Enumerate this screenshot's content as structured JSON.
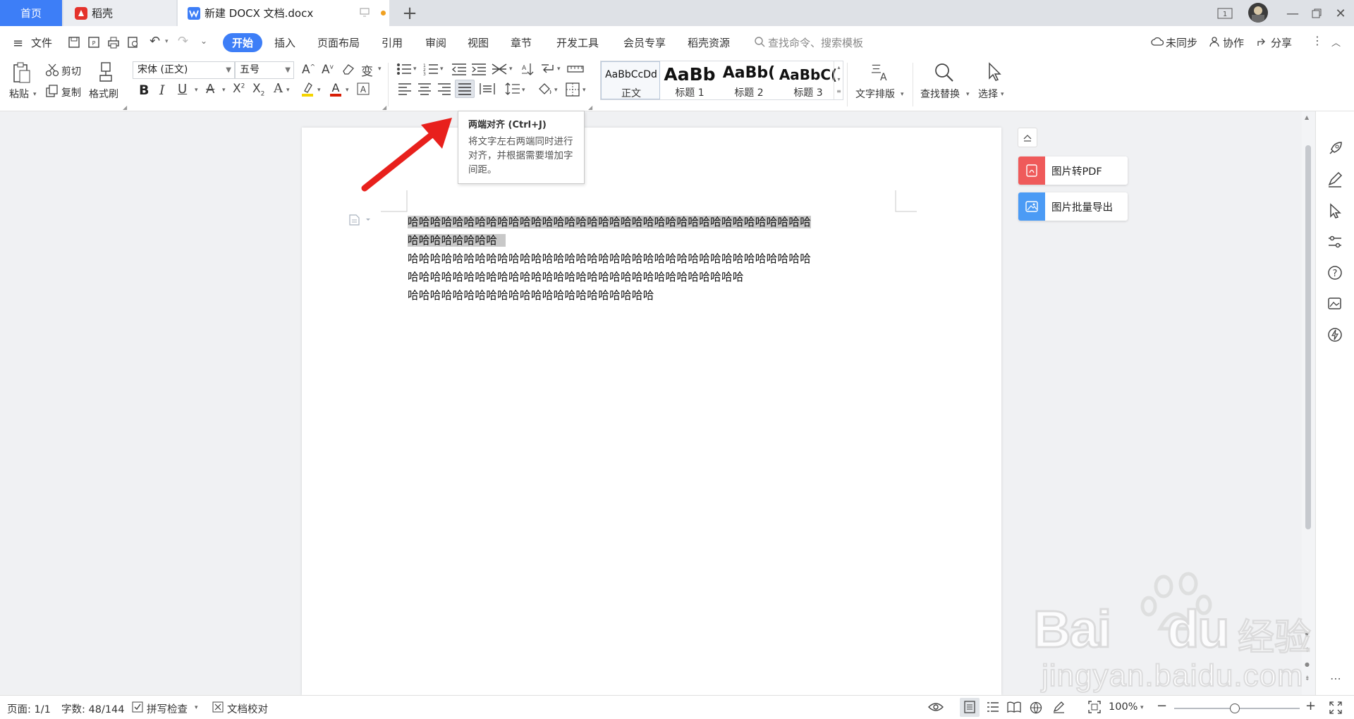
{
  "tabs": {
    "home": "首页",
    "daoke": "稻壳",
    "doc": "新建 DOCX 文档.docx",
    "new": "+"
  },
  "menu": {
    "file": "文件",
    "items": [
      "开始",
      "插入",
      "页面布局",
      "引用",
      "审阅",
      "视图",
      "章节",
      "开发工具",
      "会员专享",
      "稻壳资源"
    ],
    "search_placeholder": "查找命令、搜索模板",
    "sync": "未同步",
    "collab": "协作",
    "share": "分享"
  },
  "ribbon": {
    "paste": "粘贴",
    "cut": "剪切",
    "copy": "复制",
    "format_painter": "格式刷",
    "font_name": "宋体 (正文)",
    "font_size": "五号",
    "text_layout": "文字排版",
    "find_replace": "查找替换",
    "select": "选择",
    "styles": [
      {
        "preview": "AaBbCcDd",
        "name": "正文"
      },
      {
        "preview": "AaBb",
        "name": "标题 1"
      },
      {
        "preview": "AaBb(",
        "name": "标题 2"
      },
      {
        "preview": "AaBbC(",
        "name": "标题 3"
      }
    ]
  },
  "tooltip": {
    "title": "两端对齐 (Ctrl+J)",
    "desc": "将文字左右两端同时进行对齐，并根据需要增加字间距。"
  },
  "document": {
    "lines": [
      "哈哈哈哈哈哈哈哈哈哈哈哈哈哈哈哈哈哈哈哈哈哈哈哈哈哈哈哈哈哈哈哈哈哈哈哈",
      "哈哈哈哈哈哈哈哈",
      "哈哈哈哈哈哈哈哈哈哈哈哈哈哈哈哈哈哈哈哈哈哈哈哈哈哈哈哈哈哈哈哈哈哈哈哈",
      "哈哈哈哈哈哈哈哈哈哈哈哈哈哈哈哈哈哈哈哈哈哈哈哈哈哈哈哈哈哈",
      "哈哈哈哈哈哈哈哈哈哈哈哈哈哈哈哈哈哈哈哈哈哈"
    ]
  },
  "side_cards": {
    "img_to_pdf": "图片转PDF",
    "img_batch_export": "图片批量导出"
  },
  "status": {
    "page": "页面: 1/1",
    "words": "字数: 48/144",
    "spell": "拼写检查",
    "proof": "文档校对",
    "zoom": "100%"
  },
  "watermark": {
    "brand": "Bai",
    "brand2": "du",
    "cn": "经验",
    "url": "jingyan.baidu.com"
  },
  "colors": {
    "accent": "#3d7ef7",
    "arrow": "#e8201c",
    "pdf_card": "#ef5a5a",
    "export_card": "#4b9bf5"
  }
}
